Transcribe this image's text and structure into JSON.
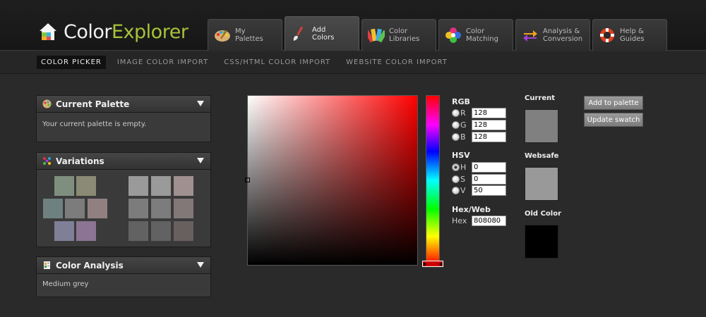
{
  "app": {
    "name_part1": "Color",
    "name_part2": "Explorer",
    "accent": "#a8c23a"
  },
  "tabs": [
    {
      "label": "My\nPalettes",
      "icon": "palette-icon"
    },
    {
      "label": "Add\nColors",
      "icon": "brush-icon",
      "active": true
    },
    {
      "label": "Color\nLibraries",
      "icon": "swatch-fan-icon"
    },
    {
      "label": "Color\nMatching",
      "icon": "flower-icon"
    },
    {
      "label": "Analysis &\nConversion",
      "icon": "convert-arrows-icon"
    },
    {
      "label": "Help &\nGuides",
      "icon": "lifebuoy-icon"
    }
  ],
  "subnav": [
    {
      "label": "COLOR PICKER",
      "active": true
    },
    {
      "label": "IMAGE COLOR IMPORT"
    },
    {
      "label": "CSS/HTML COLOR IMPORT"
    },
    {
      "label": "WEBSITE COLOR IMPORT"
    }
  ],
  "current_palette": {
    "title": "Current Palette",
    "message": "Your current palette is empty."
  },
  "variations": {
    "title": "Variations",
    "left_swatches": [
      "#7f8f7f",
      "#8a8a75",
      "#6e8080",
      "#7c7c7c",
      "#928080",
      "#7f7f98",
      "#8c7594"
    ],
    "right_swatches": [
      "#9a9a9a",
      "#9a9a9a",
      "#a09090",
      "#7c7c7c",
      "#7c7c7c",
      "#837878",
      "#626262",
      "#626262",
      "#685f5f"
    ]
  },
  "color_analysis": {
    "title": "Color Analysis",
    "message": "Medium grey"
  },
  "picker": {
    "hue_color": "#ff0000"
  },
  "rgb": {
    "label": "RGB",
    "r_label": "R",
    "g_label": "G",
    "b_label": "B",
    "r": "128",
    "g": "128",
    "b": "128"
  },
  "hsv": {
    "label": "HSV",
    "h_label": "H",
    "s_label": "S",
    "v_label": "V",
    "h": "0",
    "s": "0",
    "v": "50"
  },
  "hex": {
    "label": "Hex/Web",
    "field_label": "Hex",
    "value": "808080"
  },
  "swatches": {
    "current_label": "Current",
    "current_color": "#808080",
    "websafe_label": "Websafe",
    "websafe_color": "#999999",
    "old_label": "Old Color",
    "old_color": "#000000"
  },
  "buttons": {
    "add": "Add to palette",
    "update": "Update swatch"
  }
}
